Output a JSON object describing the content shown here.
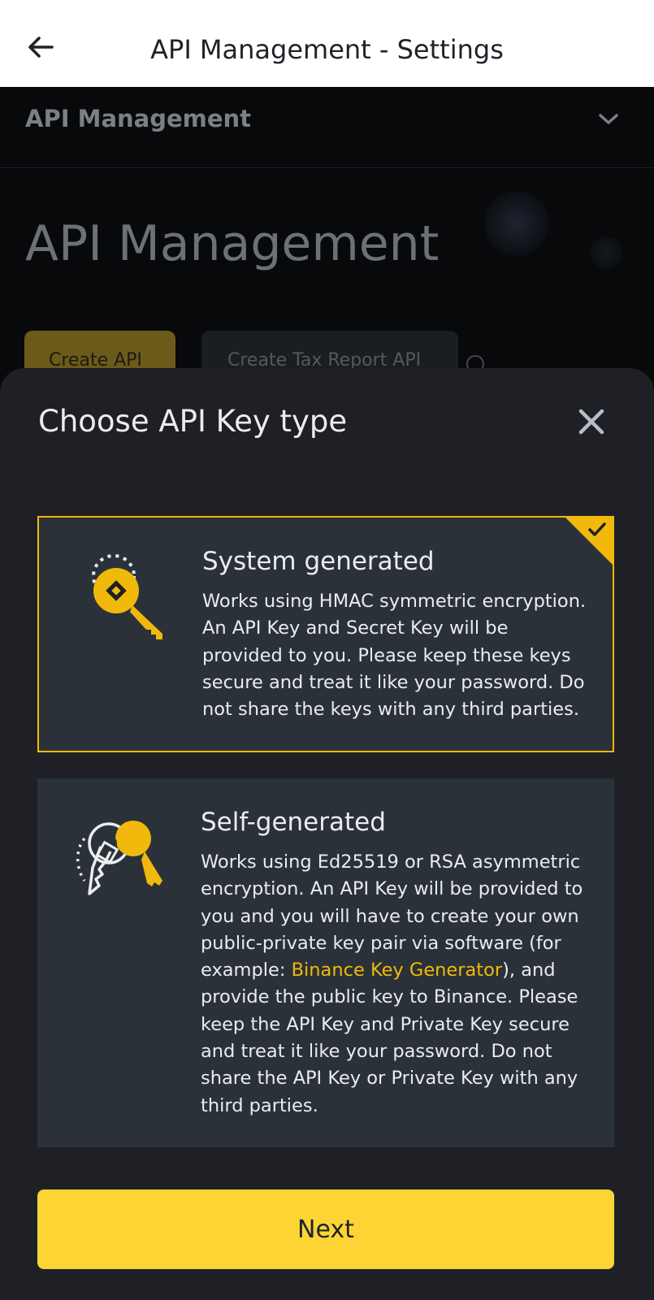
{
  "appbar": {
    "title": "API Management - Settings",
    "back_icon": "arrow-left-icon"
  },
  "background": {
    "subnav_label": "API Management",
    "heading": "API Management",
    "create_api_label": "Create API",
    "create_tax_label": "Create Tax Report API"
  },
  "sheet": {
    "title": "Choose API Key type",
    "options": [
      {
        "title": "System generated",
        "description": "Works using HMAC symmetric encryption. An API Key and Secret Key will be provided to you. Please keep these keys secure and treat it like your password. Do not share the keys with any third parties.",
        "selected": true,
        "icon": "key-icon"
      },
      {
        "title": "Self-generated",
        "description_before_link": "Works using Ed25519 or RSA asymmetric encryption. An API Key will be provided to you and you will have to create your own public-private key pair via software (for example: ",
        "link_text": "Binance Key Generator",
        "description_after_link": "), and provide the public key to Binance. Please keep the API Key and Private Key secure and treat it like your password. Do not share the API Key or Private Key with any third parties.",
        "selected": false,
        "icon": "key-pair-icon"
      }
    ],
    "next_label": "Next"
  },
  "colors": {
    "accent": "#F0B90B",
    "button": "#FCD535",
    "sheet_bg": "#1E2026",
    "card_bg": "#2B3139"
  }
}
